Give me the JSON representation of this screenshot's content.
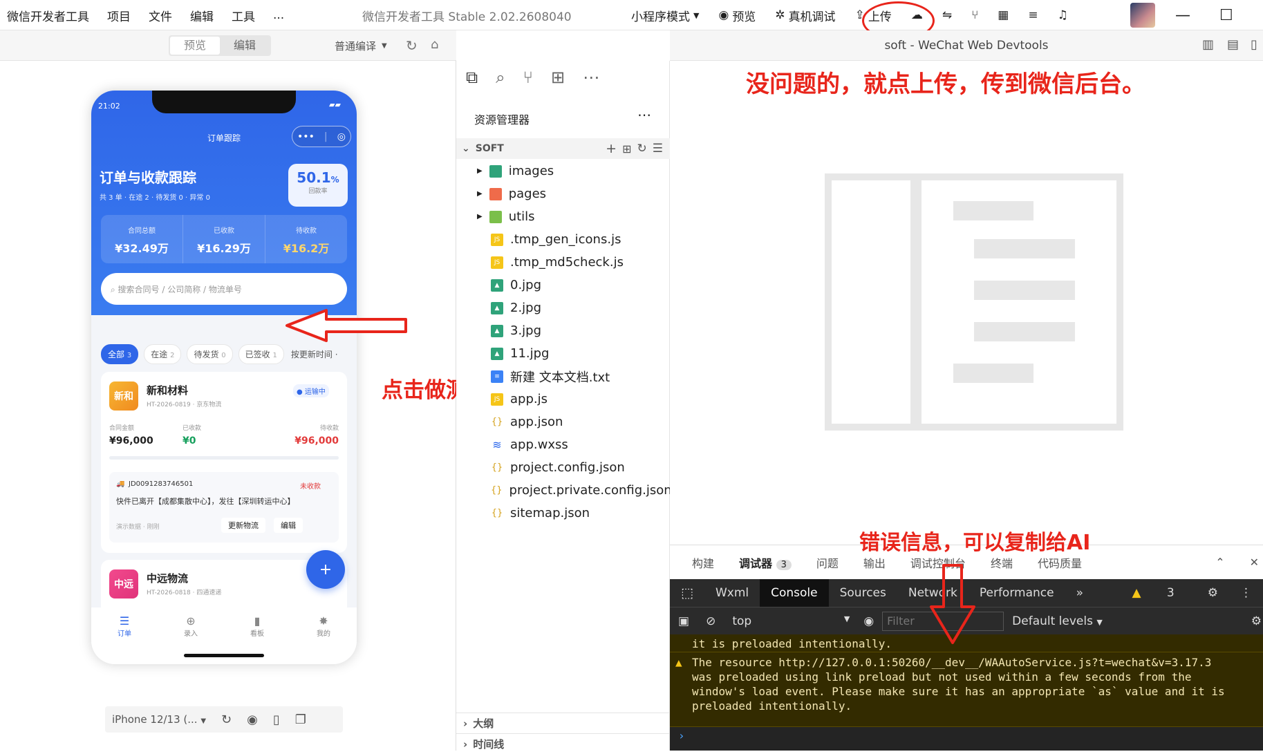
{
  "titlebar": {
    "menu": [
      "微信开发者工具",
      "项目",
      "文件",
      "编辑",
      "工具",
      "..."
    ],
    "title": "微信开发者工具 Stable 2.02.2608040",
    "mode": "小程序模式",
    "preview": "预览",
    "realdebug": "真机调试",
    "upload": "上传"
  },
  "simtoolbar": {
    "preview_tab": "预览",
    "edit_tab": "编辑",
    "compile": "普通编译"
  },
  "phone": {
    "time": "21:02",
    "nav_title": "订单跟踪",
    "heading": "订单与收款跟踪",
    "subheading": "共 3 单 · 在途 2 · 待发货 0 · 异常 0",
    "rate_value": "50.1",
    "rate_unit": "%",
    "rate_label": "回款率",
    "stats": [
      {
        "label": "合同总额",
        "value": "¥32.49万"
      },
      {
        "label": "已收款",
        "value": "¥16.29万"
      },
      {
        "label": "待收款",
        "value": "¥16.2万"
      }
    ],
    "search_placeholder": "⌕ 搜索合同号 / 公司简称 / 物流单号",
    "chips": [
      {
        "label": "全部",
        "count": "3"
      },
      {
        "label": "在途",
        "count": "2"
      },
      {
        "label": "待发货",
        "count": "0"
      },
      {
        "label": "已签收",
        "count": "1"
      }
    ],
    "sort": "按更新时间 ·",
    "card1": {
      "logo": "新和",
      "name": "新和材料",
      "meta": "HT-2026-0819 · 京东物流",
      "status": "● 运输中",
      "amt_label": "合同金额",
      "amt": "¥96,000",
      "paid_label": "已收款",
      "paid": "¥0",
      "due_label": "待收款",
      "due": "¥96,000",
      "track_no": "JD0091283746501",
      "track_status": "未收款",
      "track_text": "快件已离开【成都集散中心】，发往【深圳转运中心】",
      "track_meta": "演示数据 · 刚刚",
      "btn_update": "更新物流",
      "btn_edit": "编辑"
    },
    "card2": {
      "logo": "中远",
      "name": "中远物流",
      "meta": "HT-2026-0818 · 四通速递"
    },
    "fab": "+",
    "tabs": [
      {
        "icon": "☰",
        "label": "订单"
      },
      {
        "icon": "⊕",
        "label": "录入"
      },
      {
        "icon": "▮",
        "label": "看板"
      },
      {
        "icon": "✸",
        "label": "我的"
      }
    ]
  },
  "device": "iPhone 12/13 (...",
  "explorer": {
    "title": "资源管理器",
    "root": "SOFT",
    "folders": [
      "images",
      "pages",
      "utils"
    ],
    "files": [
      {
        "name": ".tmp_gen_icons.js",
        "type": "js"
      },
      {
        "name": ".tmp_md5check.js",
        "type": "js"
      },
      {
        "name": "0.jpg",
        "type": "img"
      },
      {
        "name": "2.jpg",
        "type": "img"
      },
      {
        "name": "3.jpg",
        "type": "img"
      },
      {
        "name": "11.jpg",
        "type": "img"
      },
      {
        "name": "新建 文本文档.txt",
        "type": "txt"
      },
      {
        "name": "app.js",
        "type": "js"
      },
      {
        "name": "app.json",
        "type": "json"
      },
      {
        "name": "app.wxss",
        "type": "wxss"
      },
      {
        "name": "project.config.json",
        "type": "json"
      },
      {
        "name": "project.private.config.json",
        "type": "json"
      },
      {
        "name": "sitemap.json",
        "type": "json"
      }
    ],
    "outline": "大纲",
    "timeline": "时间线"
  },
  "editor_title": "soft - WeChat Web Devtools",
  "annotations": {
    "upload_note": "没问题的，就点上传，传到微信后台。",
    "test_note": "点击做测试",
    "error_note": "错误信息，可以复制给AI"
  },
  "devtools": {
    "panels": [
      "构建",
      "调试器",
      "问题",
      "输出",
      "调试控制台",
      "终端",
      "代码质量"
    ],
    "debugger_count": "3",
    "tabs": [
      "Wxml",
      "Console",
      "Sources",
      "Network",
      "Performance"
    ],
    "warn_count": "3",
    "context": "top",
    "filter_placeholder": "Filter",
    "levels": "Default levels",
    "console_lines": [
      "it is preloaded intentionally.",
      "The resource http://127.0.0.1:50260/__dev__/WAAutoService.js?t=wechat&v=3.17.3",
      "was preloaded using link preload but not used within a few seconds from the",
      "window's load event. Please make sure it has an appropriate `as` value and it is",
      "preloaded intentionally."
    ],
    "prompt": "›"
  },
  "colors": {
    "accent": "#2f66e8",
    "annotation": "#e8251b"
  }
}
